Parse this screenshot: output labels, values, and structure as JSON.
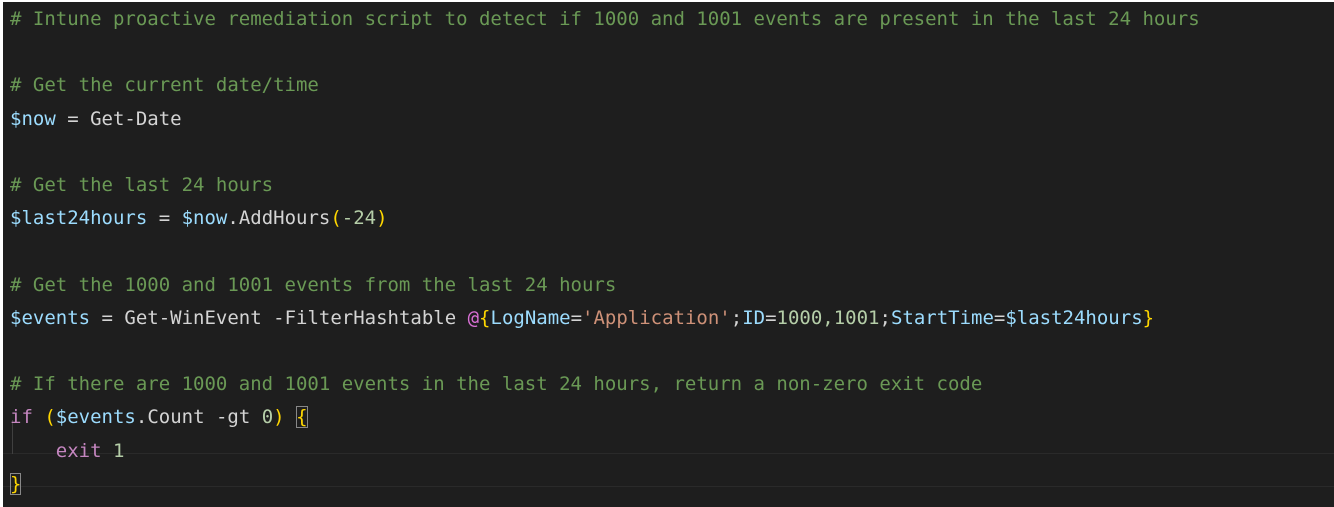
{
  "editor": {
    "lines": [
      {
        "tokens": [
          {
            "t": "comment",
            "v": "# Intune proactive remediation script to detect if 1000 and 1001 events are present in the last 24 hours"
          }
        ]
      },
      {
        "tokens": []
      },
      {
        "tokens": [
          {
            "t": "comment",
            "v": "# Get the current date/time"
          }
        ]
      },
      {
        "tokens": [
          {
            "t": "var",
            "v": "$now"
          },
          {
            "t": "op",
            "v": " = "
          },
          {
            "t": "cmdlet",
            "v": "Get-Date"
          }
        ]
      },
      {
        "tokens": []
      },
      {
        "tokens": [
          {
            "t": "comment",
            "v": "# Get the last 24 hours"
          }
        ]
      },
      {
        "tokens": [
          {
            "t": "var",
            "v": "$last24hours"
          },
          {
            "t": "op",
            "v": " = "
          },
          {
            "t": "var",
            "v": "$now"
          },
          {
            "t": "plain",
            "v": ".AddHours"
          },
          {
            "t": "paren",
            "v": "("
          },
          {
            "t": "number",
            "v": "-24"
          },
          {
            "t": "paren",
            "v": ")"
          }
        ]
      },
      {
        "tokens": []
      },
      {
        "tokens": [
          {
            "t": "comment",
            "v": "# Get the 1000 and 1001 events from the last 24 hours"
          }
        ]
      },
      {
        "tokens": [
          {
            "t": "var",
            "v": "$events"
          },
          {
            "t": "op",
            "v": " = "
          },
          {
            "t": "cmdlet",
            "v": "Get-WinEvent"
          },
          {
            "t": "plain",
            "v": " -FilterHashtable "
          },
          {
            "t": "brace",
            "v": "@"
          },
          {
            "t": "brace-gold",
            "v": "{"
          },
          {
            "t": "var",
            "v": "LogName"
          },
          {
            "t": "op",
            "v": "="
          },
          {
            "t": "string",
            "v": "'Application'"
          },
          {
            "t": "op",
            "v": ";"
          },
          {
            "t": "var",
            "v": "ID"
          },
          {
            "t": "op",
            "v": "="
          },
          {
            "t": "number",
            "v": "1000,1001"
          },
          {
            "t": "op",
            "v": ";"
          },
          {
            "t": "var",
            "v": "StartTime"
          },
          {
            "t": "op",
            "v": "="
          },
          {
            "t": "var",
            "v": "$last24hours"
          },
          {
            "t": "brace-gold",
            "v": "}"
          }
        ]
      },
      {
        "tokens": []
      },
      {
        "tokens": [
          {
            "t": "comment",
            "v": "# If there are 1000 and 1001 events in the last 24 hours, return a non-zero exit code"
          }
        ]
      },
      {
        "tokens": [
          {
            "t": "keyword",
            "v": "if"
          },
          {
            "t": "plain",
            "v": " "
          },
          {
            "t": "paren",
            "v": "("
          },
          {
            "t": "var",
            "v": "$events"
          },
          {
            "t": "plain",
            "v": ".Count -gt "
          },
          {
            "t": "number",
            "v": "0"
          },
          {
            "t": "paren",
            "v": ")"
          },
          {
            "t": "plain",
            "v": " "
          },
          {
            "t": "brace-gold-box",
            "v": "{"
          }
        ]
      },
      {
        "tokens": [
          {
            "t": "plain",
            "v": "    "
          },
          {
            "t": "keyword",
            "v": "exit"
          },
          {
            "t": "plain",
            "v": " "
          },
          {
            "t": "number",
            "v": "1"
          }
        ]
      },
      {
        "tokens": [
          {
            "t": "brace-gold-box",
            "v": "}"
          }
        ]
      }
    ]
  }
}
